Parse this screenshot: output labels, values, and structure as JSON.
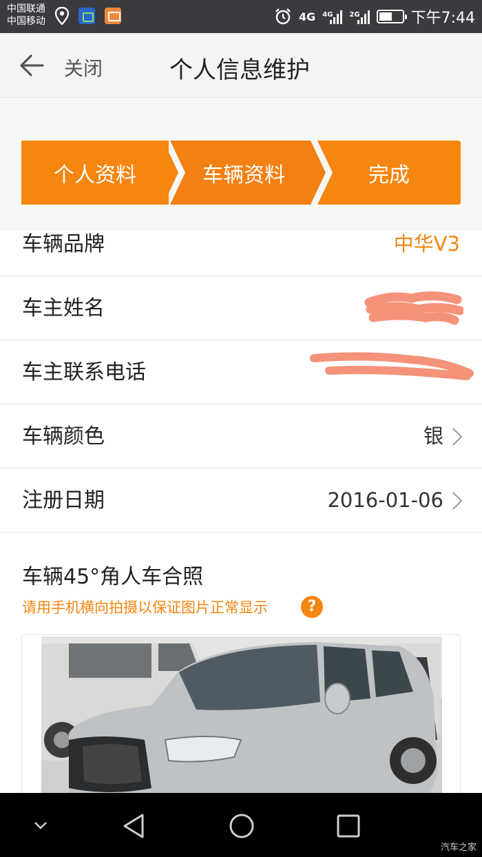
{
  "status_bar": {
    "carrier_1": "中国联通",
    "carrier_2": "中国移动",
    "network_1": "4G",
    "network_2": "4G",
    "network_3": "2G",
    "time": "下午7:44"
  },
  "header": {
    "close_label": "关闭",
    "title": "个人信息维护"
  },
  "steps": [
    {
      "label": "个人资料"
    },
    {
      "label": "车辆资料"
    },
    {
      "label": "完成"
    }
  ],
  "fields": [
    {
      "label": "车辆品牌",
      "value": "中华V3"
    },
    {
      "label": "车主姓名",
      "value": ""
    },
    {
      "label": "车主联系电话",
      "value": ""
    },
    {
      "label": "车辆颜色",
      "value": "银"
    },
    {
      "label": "注册日期",
      "value": "2016-01-06"
    }
  ],
  "photo_section": {
    "title": "车辆45°角人车合照",
    "hint": "请用手机横向拍摄以保证图片正常显示",
    "help": "?"
  },
  "watermark": "汽车之家",
  "colors": {
    "accent": "#f5860f",
    "status_bar": "#3a3a3f",
    "nav_bar": "#000000"
  }
}
